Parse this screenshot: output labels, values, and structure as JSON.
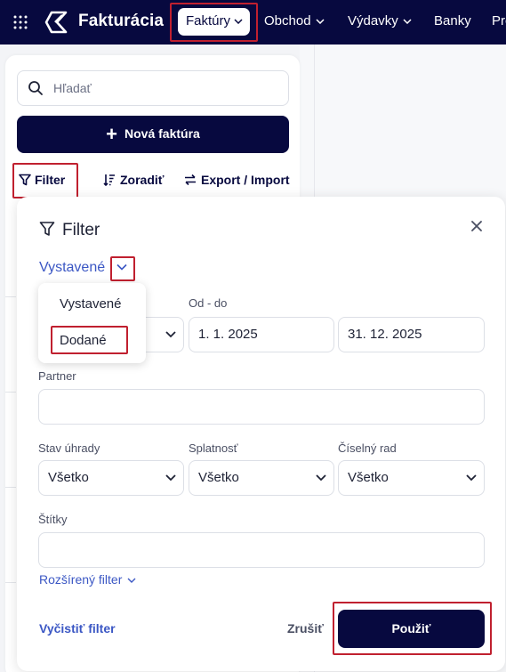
{
  "nav": {
    "brand": "Fakturácia",
    "items": [
      {
        "label": "Faktúry",
        "active": true
      },
      {
        "label": "Obchod"
      },
      {
        "label": "Výdavky"
      },
      {
        "label": "Banky"
      },
      {
        "label": "Pro"
      }
    ]
  },
  "sidebar": {
    "search_placeholder": "Hľadať",
    "new_invoice_label": "Nová faktúra",
    "filter_label": "Filter",
    "sort_label": "Zoradiť",
    "export_label": "Export / Import"
  },
  "filter_modal": {
    "title": "Filter",
    "type_selected": "Vystavené",
    "type_options": [
      "Vystavené",
      "Dodané"
    ],
    "highlighted_option": "Dodané",
    "date_range_label": "Od - do",
    "date_from": "1. 1. 2025",
    "date_to": "31. 12. 2025",
    "partner_label": "Partner",
    "partner_value": "",
    "payment_status_label": "Stav úhrady",
    "payment_status_value": "Všetko",
    "due_label": "Splatnosť",
    "due_value": "Všetko",
    "series_label": "Číselný rad",
    "series_value": "Všetko",
    "tags_label": "Štítky",
    "tags_value": "",
    "advanced_filter_label": "Rozšírený filter",
    "clear_label": "Vyčistiť filter",
    "cancel_label": "Zrušiť",
    "apply_label": "Použiť"
  },
  "colors": {
    "nav_bg": "#07093f",
    "primary": "#07093f",
    "link": "#3b57c4",
    "highlight": "#c0202f"
  }
}
